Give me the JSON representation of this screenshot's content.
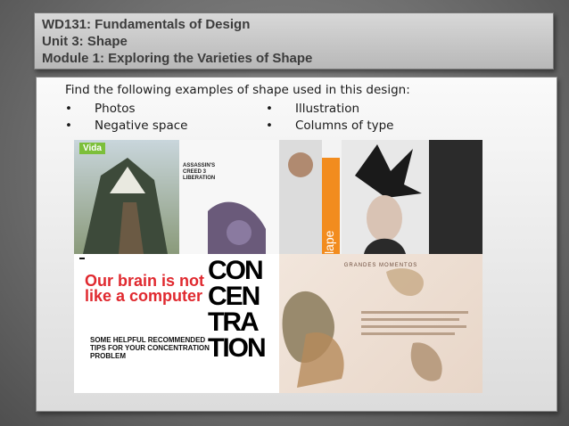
{
  "header": {
    "line1": "WD131: Fundamentals of Design",
    "line2": "Unit 3: Shape",
    "line3": "Module 1: Exploring the Varieties of Shape"
  },
  "content": {
    "instructions": "Find the following examples of shape used in this design:",
    "bullet_char": "•",
    "bullets": [
      "Photos",
      "Illustration",
      "Negative space",
      "Columns of type"
    ]
  },
  "design": {
    "vida_tag": "Vida",
    "article_title": "ASSASSIN'S CREED 3 LIBERATION",
    "lens_word": "lape",
    "quote": "Our brain is not like a computer",
    "tips_heading": "SOME HELPFUL RECOMMENDED TIPS FOR YOUR CONCENTRATION PROBLEM",
    "concentration_letters": [
      "CON",
      "CEN",
      "TRA",
      "TION"
    ],
    "grandes_momentos": "GRANDES MOMENTOS"
  },
  "colors": {
    "title_text": "#3c3c3c",
    "quote_red": "#e0292f",
    "orange": "#f28c1e",
    "green": "#7cbf3a"
  }
}
